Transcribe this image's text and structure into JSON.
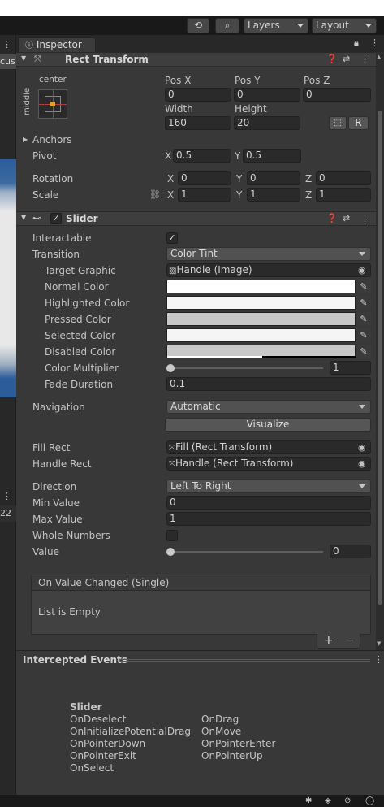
{
  "toolbar": {
    "layers_label": "Layers",
    "layout_label": "Layout"
  },
  "left_partial": {
    "cus_text": "cus",
    "num_text": "22"
  },
  "tab": {
    "label": "Inspector"
  },
  "rect_transform": {
    "title": "Rect Transform",
    "anchor_h": "center",
    "anchor_v": "middle",
    "pos_x_label": "Pos X",
    "pos_y_label": "Pos Y",
    "pos_z_label": "Pos Z",
    "pos_x": "0",
    "pos_y": "0",
    "pos_z": "0",
    "width_label": "Width",
    "height_label": "Height",
    "width": "160",
    "height": "20",
    "r_button": "R",
    "anchors_label": "Anchors",
    "pivot_label": "Pivot",
    "pivot_x_label": "X",
    "pivot_x": "0.5",
    "pivot_y_label": "Y",
    "pivot_y": "0.5",
    "rotation_label": "Rotation",
    "rot_x_label": "X",
    "rot_x": "0",
    "rot_y_label": "Y",
    "rot_y": "0",
    "rot_z_label": "Z",
    "rot_z": "0",
    "scale_label": "Scale",
    "scale_x_label": "X",
    "scale_x": "1",
    "scale_y_label": "Y",
    "scale_y": "1",
    "scale_z_label": "Z",
    "scale_z": "1"
  },
  "slider": {
    "title": "Slider",
    "interactable_label": "Interactable",
    "interactable_checked": true,
    "transition_label": "Transition",
    "transition_value": "Color Tint",
    "target_graphic_label": "Target Graphic",
    "target_graphic_value": "Handle (Image)",
    "normal_color_label": "Normal Color",
    "normal_color": "#ffffff",
    "highlighted_color_label": "Highlighted Color",
    "highlighted_color": "#f5f5f5",
    "pressed_color_label": "Pressed Color",
    "pressed_color": "#c8c8c8",
    "selected_color_label": "Selected Color",
    "selected_color": "#f5f5f5",
    "disabled_color_label": "Disabled Color",
    "disabled_color": "#c8c8c8",
    "color_multiplier_label": "Color Multiplier",
    "color_multiplier": "1",
    "color_multiplier_fraction": 0.0,
    "fade_duration_label": "Fade Duration",
    "fade_duration": "0.1",
    "navigation_label": "Navigation",
    "navigation_value": "Automatic",
    "visualize_label": "Visualize",
    "fill_rect_label": "Fill Rect",
    "fill_rect_value": "Fill (Rect Transform)",
    "handle_rect_label": "Handle Rect",
    "handle_rect_value": "Handle (Rect Transform)",
    "direction_label": "Direction",
    "direction_value": "Left To Right",
    "min_value_label": "Min Value",
    "min_value": "0",
    "max_value_label": "Max Value",
    "max_value": "1",
    "whole_numbers_label": "Whole Numbers",
    "value_label": "Value",
    "value": "0",
    "value_fraction": 0.0,
    "on_value_changed_label": "On Value Changed (Single)",
    "list_empty_label": "List is Empty",
    "add_label": "+",
    "remove_label": "−"
  },
  "intercepted": {
    "title": "Intercepted Events",
    "heading": "Slider",
    "col1": [
      "OnDeselect",
      "OnInitializePotentialDrag",
      "OnPointerDown",
      "OnPointerExit",
      "OnSelect"
    ],
    "col2": [
      "OnDrag",
      "OnMove",
      "OnPointerEnter",
      "OnPointerUp"
    ]
  }
}
